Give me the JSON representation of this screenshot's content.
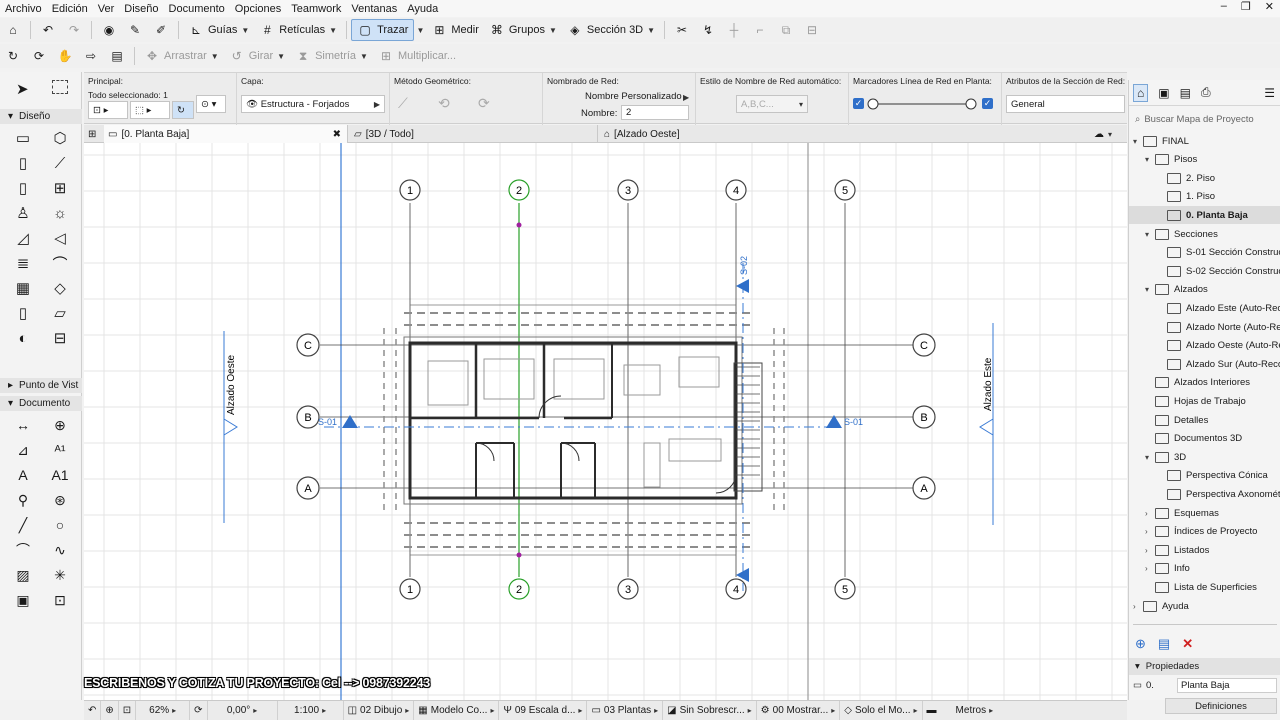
{
  "menu": [
    "Archivo",
    "Edición",
    "Ver",
    "Diseño",
    "Documento",
    "Opciones",
    "Teamwork",
    "Ventanas",
    "Ayuda"
  ],
  "toolbar1": {
    "guias": "Guías",
    "reticulas": "Retículas",
    "trazar": "Trazar",
    "medir": "Medir",
    "grupos": "Grupos",
    "seccion3d": "Sección 3D"
  },
  "toolbar2": {
    "arrastrar": "Arrastrar",
    "girar": "Girar",
    "simetria": "Simetría",
    "multiplicar": "Multiplicar..."
  },
  "infobox": {
    "principal_label": "Principal:",
    "todo_seleccionado": "Todo seleccionado: 1",
    "capa_label": "Capa:",
    "capa_value": "Estructura - Forjados",
    "metodo_label": "Método Geométrico:",
    "nombrado_label": "Nombrado de Red:",
    "nombrado_value": "Nombre Personalizado",
    "nombre_label": "Nombre:",
    "nombre_value": "2",
    "estilo_label": "Estilo de Nombre de Red automático:",
    "estilo_value": "A,B,C...",
    "marcadores_label": "Marcadores Línea de Red en Planta:",
    "atributos_label": "Atributos de la Sección de Red:",
    "atributos_value": "General"
  },
  "toolbox": {
    "diseno": "Diseño",
    "punto_vista": "Punto de Vist",
    "documento": "Documento"
  },
  "tabs": {
    "planta": "[0. Planta Baja]",
    "vista3d": "[3D / Todo]",
    "alzado": "[Alzado Oeste]"
  },
  "plan": {
    "axis_numbers": [
      "1",
      "2",
      "3",
      "4",
      "5"
    ],
    "axis_letters": [
      "C",
      "B",
      "A"
    ],
    "section_s01": "S-01",
    "section_s02": "S-02",
    "alzado_oeste": "Alzado Oeste",
    "alzado_este": "Alzado Este"
  },
  "navigator": {
    "search_placeholder": "Buscar Mapa de Proyecto",
    "items": [
      {
        "label": "FINAL",
        "level": 0,
        "arrow": "▾"
      },
      {
        "label": "Pisos",
        "level": 1,
        "arrow": "▾"
      },
      {
        "label": "2. Piso",
        "level": 2,
        "arrow": ""
      },
      {
        "label": "1. Piso",
        "level": 2,
        "arrow": ""
      },
      {
        "label": "0. Planta Baja",
        "level": 2,
        "arrow": "",
        "selected": true
      },
      {
        "label": "Secciones",
        "level": 1,
        "arrow": "▾"
      },
      {
        "label": "S-01 Sección Constructi",
        "level": 2,
        "arrow": ""
      },
      {
        "label": "S-02 Sección Constructi",
        "level": 2,
        "arrow": ""
      },
      {
        "label": "Alzados",
        "level": 1,
        "arrow": "▾"
      },
      {
        "label": "Alzado Este (Auto-Reco",
        "level": 2,
        "arrow": ""
      },
      {
        "label": "Alzado Norte (Auto-Rec",
        "level": 2,
        "arrow": ""
      },
      {
        "label": "Alzado Oeste (Auto-Rec",
        "level": 2,
        "arrow": ""
      },
      {
        "label": "Alzado Sur (Auto-Recon",
        "level": 2,
        "arrow": ""
      },
      {
        "label": "Alzados Interiores",
        "level": 1,
        "arrow": ""
      },
      {
        "label": "Hojas de Trabajo",
        "level": 1,
        "arrow": ""
      },
      {
        "label": "Detalles",
        "level": 1,
        "arrow": ""
      },
      {
        "label": "Documentos 3D",
        "level": 1,
        "arrow": ""
      },
      {
        "label": "3D",
        "level": 1,
        "arrow": "▾"
      },
      {
        "label": "Perspectiva Cónica",
        "level": 2,
        "arrow": ""
      },
      {
        "label": "Perspectiva Axonométric",
        "level": 2,
        "arrow": ""
      },
      {
        "label": "Esquemas",
        "level": 1,
        "arrow": "›"
      },
      {
        "label": "Índices de Proyecto",
        "level": 1,
        "arrow": "›"
      },
      {
        "label": "Listados",
        "level": 1,
        "arrow": "›"
      },
      {
        "label": "Info",
        "level": 1,
        "arrow": "›"
      },
      {
        "label": "Lista de Superficies",
        "level": 1,
        "arrow": ""
      },
      {
        "label": "Ayuda",
        "level": 0,
        "arrow": "›"
      }
    ],
    "propiedades": "Propiedades",
    "prop_id": "0.",
    "prop_name": "Planta Baja",
    "definiciones": "Definiciones"
  },
  "statusbar": {
    "zoom": "62%",
    "angle": "0,00°",
    "scale": "1:100",
    "dibujo": "02 Dibujo",
    "modelo": "Modelo Co...",
    "escala": "09 Escala d...",
    "plantas": "03 Plantas",
    "sobrescr": "Sin Sobrescr...",
    "mostrar": "00 Mostrar...",
    "solo": "Solo el Mo...",
    "metros": "Metros"
  },
  "banner": "ESCRIBENOS Y COTIZA TU PROYECTO: Cel -->  0987392243"
}
